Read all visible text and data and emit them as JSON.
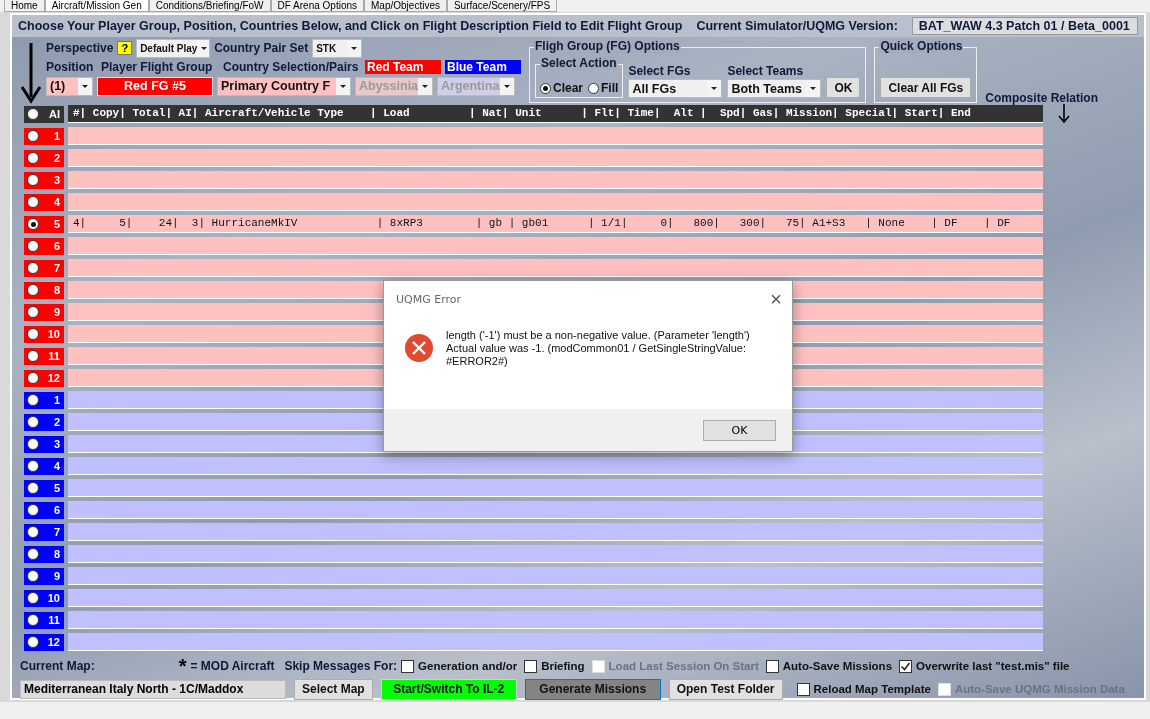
{
  "tabs": [
    {
      "label": "Home",
      "selected": false
    },
    {
      "label": "Aircraft/Mission Gen",
      "selected": true
    },
    {
      "label": "Conditions/Briefing/FoW",
      "selected": false
    },
    {
      "label": "DF Arena Options",
      "selected": false
    },
    {
      "label": "Map/Objectives",
      "selected": false
    },
    {
      "label": "Surface/Scenery/FPS",
      "selected": false
    }
  ],
  "header": {
    "title": "Choose Your Player Group, Position, Countries Below, and Click on Flight Description Field to Edit Flight Group",
    "version_label": "Current Simulator/UQMG Version:",
    "version": "BAT_WAW 4.3 Patch 01 / Beta_0001"
  },
  "perspective": {
    "label": "Perspective",
    "help": "?",
    "value": "Default Play"
  },
  "country_pair_set": {
    "label": "Country Pair Set",
    "value": "STK"
  },
  "position": {
    "label": "Position",
    "value": "(1)"
  },
  "player_flight_group": {
    "label": "Player Flight Group",
    "value": "Red FG #5"
  },
  "country_selection": {
    "label": "Country Selection/Pairs",
    "value": "Primary Country F"
  },
  "red_team": {
    "label": "Red Team",
    "value": "Abyssinia",
    "disabled": true
  },
  "blue_team": {
    "label": "Blue Team",
    "value": "Argentina",
    "disabled": true
  },
  "fg_options": {
    "title": "Fligh Group (FG) Options",
    "select_action": {
      "label": "Select Action",
      "options": [
        {
          "label": "Clear",
          "selected": true
        },
        {
          "label": "Fill",
          "selected": false
        }
      ]
    },
    "select_fgs": {
      "label": "Select FGs",
      "value": "All FGs"
    },
    "select_teams": {
      "label": "Select Teams",
      "value": "Both Teams"
    },
    "ok": "OK"
  },
  "quick_options": {
    "title": "Quick Options",
    "button": "Clear All FGs"
  },
  "composite_relation": "Composite Relation",
  "table": {
    "ai_label": "AI",
    "header": "#| Copy| Total| AI| Aircraft/Vehicle Type    | Load         | Nat| Unit      | Flt| Time|  Alt |  Spd| Gas| Mission| Special| Start| End",
    "rows": [
      {
        "kind": "red",
        "number": "1",
        "selected": false
      },
      {
        "kind": "red",
        "number": "2",
        "selected": false
      },
      {
        "kind": "red",
        "number": "3",
        "selected": false
      },
      {
        "kind": "red",
        "number": "4",
        "selected": false
      },
      {
        "kind": "red",
        "number": "5",
        "selected": true,
        "text": "4|     5|    24|  3| HurricaneMkIV            | 8xRP3        | gb | gb01      | 1/1|     0|   800|   300|   75| A1+S3   | None    | DF    | DF"
      },
      {
        "kind": "red",
        "number": "6",
        "selected": false
      },
      {
        "kind": "red",
        "number": "7",
        "selected": false
      },
      {
        "kind": "red",
        "number": "8",
        "selected": false
      },
      {
        "kind": "red",
        "number": "9",
        "selected": false
      },
      {
        "kind": "red",
        "number": "10",
        "selected": false
      },
      {
        "kind": "red",
        "number": "11",
        "selected": false
      },
      {
        "kind": "red",
        "number": "12",
        "selected": false
      },
      {
        "kind": "blue",
        "number": "1",
        "selected": false
      },
      {
        "kind": "blue",
        "number": "2",
        "selected": false
      },
      {
        "kind": "blue",
        "number": "3",
        "selected": false
      },
      {
        "kind": "blue",
        "number": "4",
        "selected": false
      },
      {
        "kind": "blue",
        "number": "5",
        "selected": false
      },
      {
        "kind": "blue",
        "number": "6",
        "selected": false
      },
      {
        "kind": "blue",
        "number": "7",
        "selected": false
      },
      {
        "kind": "blue",
        "number": "8",
        "selected": false
      },
      {
        "kind": "blue",
        "number": "9",
        "selected": false
      },
      {
        "kind": "blue",
        "number": "10",
        "selected": false
      },
      {
        "kind": "blue",
        "number": "11",
        "selected": false
      },
      {
        "kind": "blue",
        "number": "12",
        "selected": false
      }
    ]
  },
  "current_map": {
    "label": "Current Map:",
    "value": "Mediterranean Italy North - 1C/Maddox"
  },
  "mod_note": {
    "mark": "*",
    "text": "= MOD Aircraft"
  },
  "skip_label": "Skip Messages For:",
  "options_row1": [
    {
      "label": "Generation and/or",
      "checked": false,
      "disabled": false
    },
    {
      "label": "Briefing",
      "checked": false,
      "disabled": false
    },
    {
      "label": "Load Last Session On Start",
      "checked": false,
      "disabled": true
    },
    {
      "label": "Auto-Save Missions",
      "checked": false,
      "disabled": false
    },
    {
      "label": "Overwrite last \"test.mis\" file",
      "checked": true,
      "disabled": false
    }
  ],
  "buttons": [
    {
      "label": "Select Map",
      "kind": "plain"
    },
    {
      "label": "Start/Switch To IL-2",
      "kind": "green"
    },
    {
      "label": "Generate Missions",
      "kind": "dark"
    },
    {
      "label": "Open Test Folder",
      "kind": "plain"
    }
  ],
  "options_row2": [
    {
      "label": "Reload Map Template",
      "checked": false,
      "disabled": false
    },
    {
      "label": "Auto-Save UQMG Mission Data",
      "checked": false,
      "disabled": true
    }
  ],
  "dialog": {
    "title": "UQMG Error",
    "close": "×",
    "lines": [
      "length ('-1') must be a non-negative value. (Parameter 'length')",
      "Actual value was -1. (modCommon01 / GetSingleStringValue: #ERROR2#)"
    ],
    "button": "OK"
  }
}
